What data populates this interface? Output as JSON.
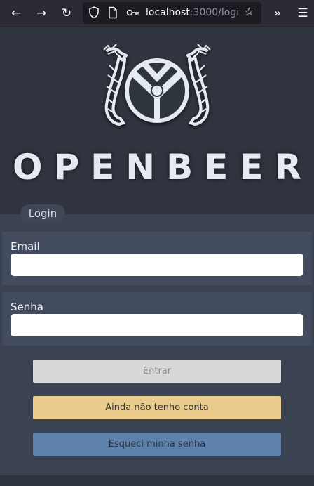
{
  "browser": {
    "back_icon": "arrow-left-icon",
    "forward_icon": "arrow-right-icon",
    "reload_icon": "reload-icon",
    "url_host": "localhost",
    "url_rest": ":3000/logi",
    "overflow_icon": "chevrons-right-icon",
    "menu_icon": "hamburger-icon"
  },
  "brand": {
    "name": "OPENBEER"
  },
  "login": {
    "tab_label": "Login",
    "email_label": "Email",
    "email_value": "",
    "password_label": "Senha",
    "password_value": "",
    "submit_label": "Entrar",
    "register_label": "Ainda não tenho conta",
    "forgot_label": "Esqueci minha senha"
  },
  "colors": {
    "background": "#2e3440",
    "panel": "#3b4252",
    "field_panel": "#434c5e",
    "submit_disabled": "#d8d8d8",
    "register": "#ebcb8b",
    "forgot": "#5e81ac"
  }
}
